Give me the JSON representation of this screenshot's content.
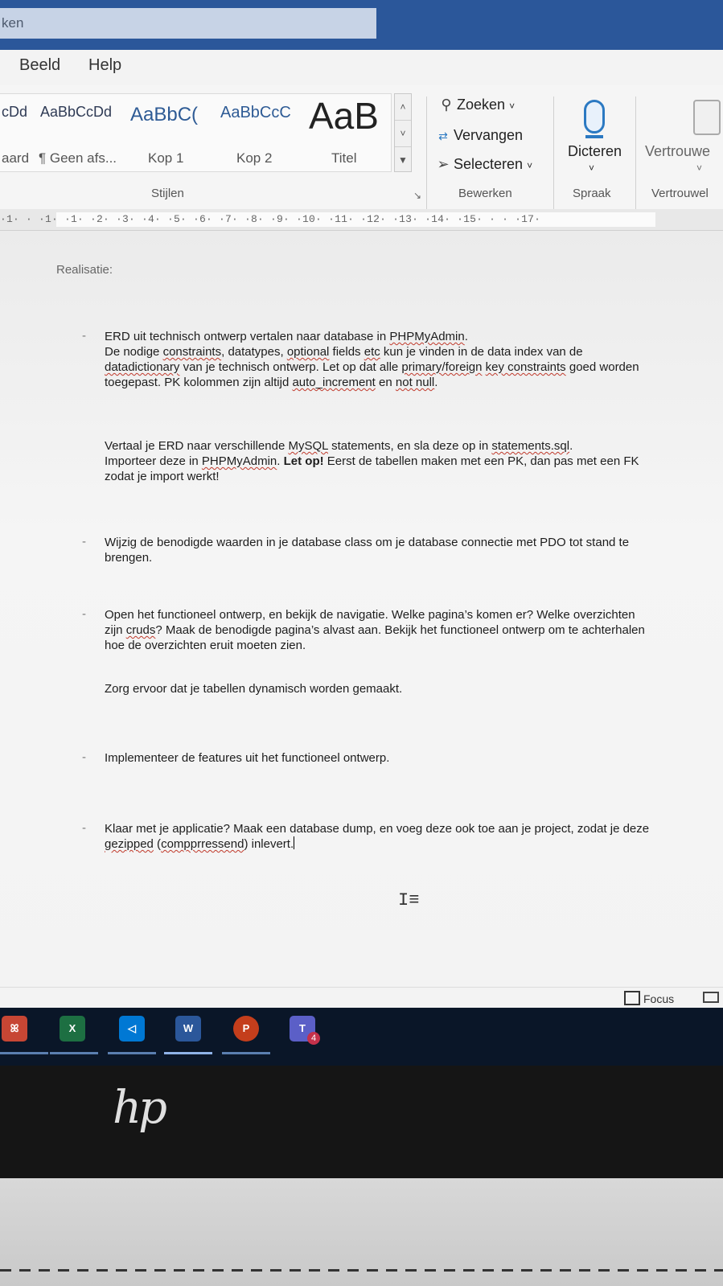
{
  "titlebar": {
    "search_text": "ken"
  },
  "menu": {
    "items": [
      "Beeld",
      "Help"
    ]
  },
  "ribbon": {
    "styles": [
      {
        "sample": "cDd",
        "name": "aard"
      },
      {
        "sample": "AaBbCcDd",
        "name": "¶ Geen afs..."
      },
      {
        "sample": "AaBbC(",
        "name": "Kop 1"
      },
      {
        "sample": "AaBbCcC",
        "name": "Kop 2"
      },
      {
        "sample": "AaB",
        "name": "Titel"
      }
    ],
    "styles_group_label": "Stijlen",
    "bewerken": {
      "zoeken": "Zoeken",
      "vervangen": "Vervangen",
      "selecteren": "Selecteren",
      "label": "Bewerken"
    },
    "spraak": {
      "dicteren": "Dicteren",
      "label": "Spraak"
    },
    "vertrouwelijk": {
      "button": "Vertrouwe",
      "label": "Vertrouwel"
    }
  },
  "ruler": {
    "text": "·1· · ·1· ·1· ·2· ·3· ·4· ·5· ·6· ·7· ·8· ·9· ·10· ·11· ·12· ·13· ·14· ·15· · · ·17·"
  },
  "document": {
    "heading": "Realisatie:",
    "p1": {
      "a": "ERD uit technisch ontwerp vertalen naar database in ",
      "b": "PHPMyAdmin",
      "c": ".",
      "d": "De nodige ",
      "e": "constraints",
      "f": ", datatypes, ",
      "g": "optional",
      "h": " fields ",
      "i": "etc",
      "j": " kun je vinden in de data index van de",
      "k": "datadictionary",
      "l": " van je technisch ontwerp. Let op dat alle ",
      "m": "primary/foreign",
      "n": " ",
      "o": "key constraints",
      "p": " goed worden toegepast. PK kolommen zijn altijd ",
      "q": "auto_increment",
      "r": " en ",
      "s": "not null",
      "t": "."
    },
    "p2": {
      "a": "Vertaal je ERD naar verschillende ",
      "b": "MySQL",
      "c": " statements, en sla deze op in ",
      "d": "statements.sql",
      "e": ".",
      "f": "Importeer deze in ",
      "g": "PHPMyAdmin",
      "h": ". ",
      "i": "Let op!",
      "j": " Eerst de tabellen maken met een PK, dan pas met een FK zodat je import werkt!"
    },
    "p3": "Wijzig de benodigde waarden in je database class om je database connectie met PDO tot stand te brengen.",
    "p4": {
      "a": "Open het functioneel ontwerp, en bekijk de navigatie. Welke pagina’s komen er? Welke overzichten zijn ",
      "b": "cruds",
      "c": "? Maak de benodigde pagina’s alvast aan. Bekijk het functioneel ontwerp om te achterhalen hoe de overzichten eruit moeten zien."
    },
    "p5": "Zorg ervoor dat je tabellen dynamisch worden gemaakt.",
    "p6": "Implementeer de features uit het functioneel ontwerp.",
    "p7": {
      "a": "Klaar met je applicatie? Maak een database dump, en voeg deze ook toe aan je project, zodat je deze ",
      "b": "gezipped",
      "c": " (",
      "d": "compprressend",
      "e": ") inlevert."
    },
    "dash": "-"
  },
  "statusbar": {
    "focus": "Focus"
  },
  "taskbar": {
    "apps": [
      {
        "label": "ꕤ",
        "color": "#c74634"
      },
      {
        "label": "X",
        "color": "#1d6f42"
      },
      {
        "label": "◁",
        "color": "#0078d4"
      },
      {
        "label": "W",
        "color": "#2b579a"
      },
      {
        "label": "P",
        "color": "#c43e1c"
      },
      {
        "label": "T",
        "color": "#5b5fc7"
      }
    ],
    "teams_badge": "4"
  },
  "brand": {
    "logo": "hp"
  }
}
